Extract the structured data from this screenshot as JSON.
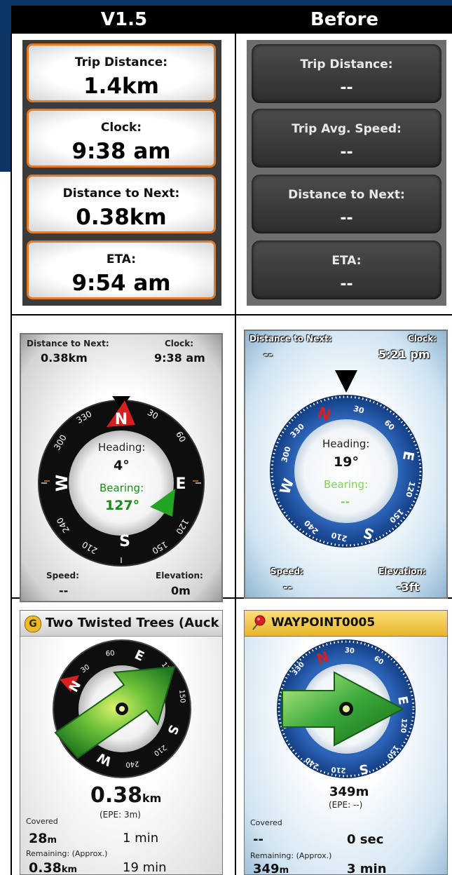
{
  "headers": {
    "left": "V1.5",
    "right": "Before"
  },
  "data_fields_new": [
    {
      "label": "Trip Distance:",
      "value": "1.4km"
    },
    {
      "label": "Clock:",
      "value": "9:38 am"
    },
    {
      "label": "Distance to Next:",
      "value": "0.38km"
    },
    {
      "label": "ETA:",
      "value": "9:54 am"
    }
  ],
  "data_fields_old": [
    {
      "label": "Trip Distance:",
      "value": "--"
    },
    {
      "label": "Trip Avg. Speed:",
      "value": "--"
    },
    {
      "label": "Distance to Next:",
      "value": "--"
    },
    {
      "label": "ETA:",
      "value": "--"
    }
  ],
  "compass_new": {
    "dist_label": "Distance to Next:",
    "dist_value": "0.38km",
    "clock_label": "Clock:",
    "clock_value": "9:38 am",
    "heading_label": "Heading:",
    "heading_value": "4°",
    "bearing_label": "Bearing:",
    "bearing_value": "127°",
    "speed_label": "Speed:",
    "speed_value": "--",
    "elev_label": "Elevation:",
    "elev_value": "0m",
    "ticks": {
      "n": "N",
      "e": "E",
      "s": "S",
      "w": "W",
      "t30": "30",
      "t60": "60",
      "t120": "120",
      "t150": "150",
      "t210": "210",
      "t240": "240",
      "t300": "300",
      "t330": "330"
    },
    "colors": {
      "bearing": "#1a8a1a",
      "north": "#d62020",
      "ring": "#111111"
    }
  },
  "compass_old": {
    "dist_label": "Distance to Next:",
    "dist_value": "--",
    "clock_label": "Clock:",
    "clock_value": "5:21 pm",
    "heading_label": "Heading:",
    "heading_value": "19°",
    "bearing_label": "Bearing:",
    "bearing_value": "--",
    "speed_label": "Speed:",
    "speed_value": "--",
    "elev_label": "Elevation:",
    "elev_value": "-3ft",
    "ticks": {
      "n": "N",
      "e": "E",
      "s": "S",
      "w": "W",
      "t30": "30",
      "t60": "60",
      "t120": "120",
      "t150": "150",
      "t210": "210",
      "t240": "240",
      "t300": "300",
      "t330": "330"
    },
    "colors": {
      "ring": "#1b4fa0",
      "north": "#d62020",
      "bearing": "#7fcf5a"
    }
  },
  "nav_new": {
    "badge": "G",
    "title": "Two Twisted Trees (Auck",
    "distance_value": "0.38",
    "distance_unit": "km",
    "epe": "(EPE: 3m)",
    "covered_label": "Covered",
    "covered_dist_value": "28",
    "covered_dist_unit": "m",
    "covered_time": "1 min",
    "remaining_label": "Remaining: (Approx.)",
    "remaining_dist_value": "0.38",
    "remaining_dist_unit": "km",
    "remaining_time": "19 min",
    "ticks": {
      "n": "N",
      "e": "E",
      "s": "S",
      "w": "W",
      "t30": "30",
      "t60": "60",
      "t120": "120",
      "t150": "150",
      "t210": "210",
      "t240": "240"
    }
  },
  "nav_old": {
    "title": "WAYPOINT0005",
    "distance": "349m",
    "epe": "(EPE: --)",
    "covered_label": "Covered",
    "covered_dist": "--",
    "covered_time": "0 sec",
    "remaining_label": "Remaining: (Approx.)",
    "remaining_dist_value": "349",
    "remaining_dist_unit": "m",
    "remaining_time": "3 min",
    "ticks": {
      "n": "N",
      "e": "E",
      "s": "S",
      "w": "W",
      "t30": "30",
      "t60": "60",
      "t120": "120",
      "t150": "150",
      "t210": "210",
      "t240": "240",
      "t330": "330"
    }
  }
}
